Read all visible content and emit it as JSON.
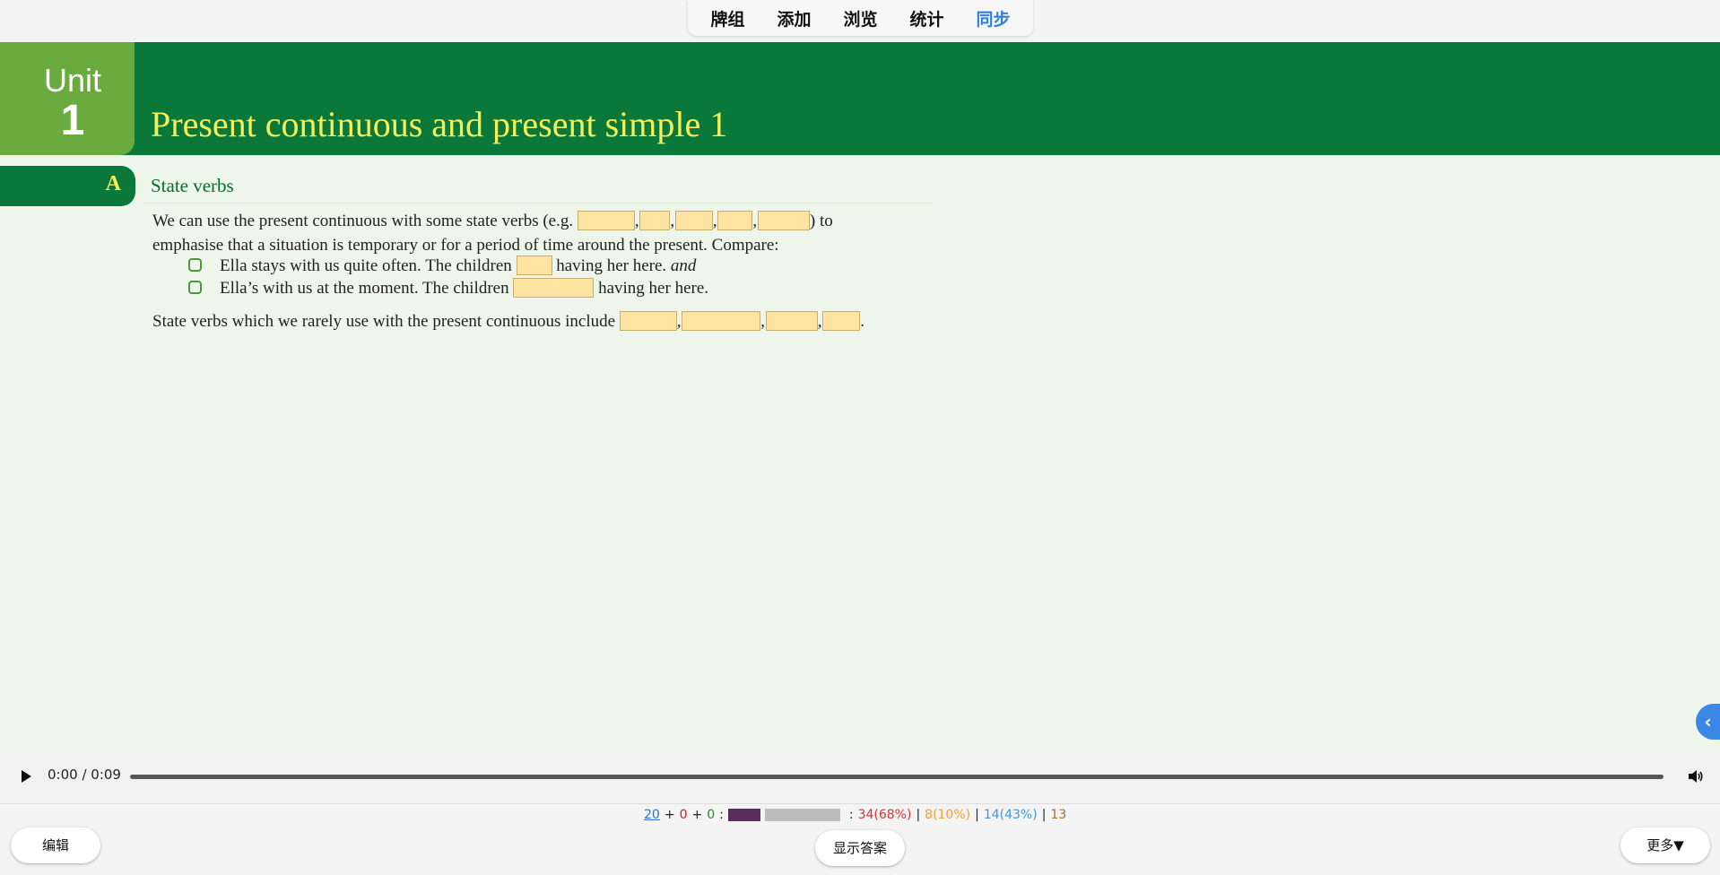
{
  "nav": {
    "items": [
      {
        "label": "牌组"
      },
      {
        "label": "添加"
      },
      {
        "label": "浏览"
      },
      {
        "label": "统计"
      },
      {
        "label": "同步"
      }
    ]
  },
  "unit": {
    "word": "Unit",
    "number": "1",
    "title": "Present continuous and present simple 1"
  },
  "section": {
    "letter": "A",
    "heading": "State verbs",
    "line1_a": "We can use the present continuous with some state verbs (e.g.",
    "line1_b": ") to",
    "line2": "emphasise that a situation is temporary or for a period of time around the present. Compare:",
    "ex1_a": "Ella stays with us quite often. The children",
    "ex1_b": "having her here.",
    "ex1_and": "and",
    "ex2_a": "Ella’s with us at the moment. The children",
    "ex2_b": "having her here.",
    "line3": "State verbs which we rarely use with the present continuous include"
  },
  "audio": {
    "time": "0:00 / 0:09"
  },
  "stats": {
    "new": "20",
    "plus1": "+",
    "learn": "0",
    "plus2": "+",
    "review": "0",
    "colon": ":",
    "progress_fraction": 0.28,
    "colon2": ":",
    "a": "34(68%)",
    "sep1": "|",
    "b": "8(10%)",
    "sep2": "|",
    "c": "14(43%)",
    "sep3": "|",
    "d": "13"
  },
  "buttons": {
    "edit": "编辑",
    "show_answer": "显示答案",
    "more": "更多▼"
  },
  "colors": {
    "banner_green": "#0a7838",
    "unit_green": "#6aaa3e",
    "title_yellow": "#f5ef5a",
    "blank_fill": "#ffe3a0",
    "sync_blue": "#2f7fe0"
  }
}
